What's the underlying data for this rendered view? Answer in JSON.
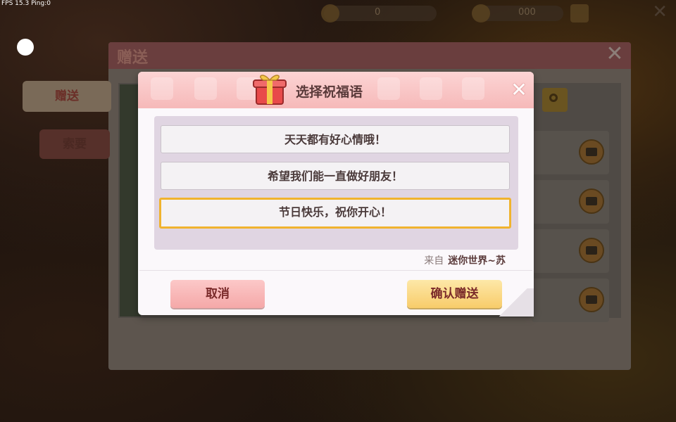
{
  "hud": {
    "fps_text": "FPS 15.3  Ping:0",
    "currency1": "0",
    "currency2": "000"
  },
  "back_panel": {
    "title": "赠送",
    "tabs": [
      {
        "label": "赠送"
      },
      {
        "label": "索要"
      }
    ]
  },
  "dialog": {
    "title": "选择祝福语",
    "options": [
      {
        "text": "天天都有好心情哦！",
        "selected": false
      },
      {
        "text": "希望我们能一直做好朋友！",
        "selected": false
      },
      {
        "text": "节日快乐，祝你开心！",
        "selected": true
      }
    ],
    "from_label": "来自",
    "from_name": "迷你世界~苏",
    "cancel_label": "取消",
    "confirm_label": "确认赠送"
  },
  "colors": {
    "header": "#f6b9b9",
    "selected_border": "#f0b32e",
    "cancel_button": "#f5a8a8",
    "confirm_button": "#f8cc6a"
  }
}
